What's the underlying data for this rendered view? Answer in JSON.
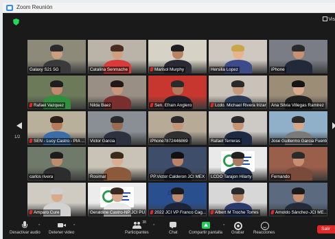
{
  "window": {
    "title": "Zoom Reunión"
  },
  "view": {
    "label": "Vis"
  },
  "pagination": {
    "page": "1/2"
  },
  "participants": [
    {
      "name": "Galaxy S21 5G",
      "muted": false
    },
    {
      "name": "Catalina Senmache",
      "muted": false
    },
    {
      "name": "Marisol Murphy",
      "muted": true
    },
    {
      "name": "Hersilia Lopez",
      "muted": false
    },
    {
      "name": "iPhone",
      "muted": false
    },
    {
      "name": "Rafael Vazquez",
      "muted": true
    },
    {
      "name": "Nilda Baez",
      "muted": false
    },
    {
      "name": "Sen. Efrain Anglero",
      "muted": true
    },
    {
      "name": "Lcdo. Michael Rivera Irizarry",
      "muted": true
    },
    {
      "name": "Ana Silvia Villegas Ramirez",
      "muted": false
    },
    {
      "name": "SEN - Lucy Castro - PIA ...",
      "muted": true
    },
    {
      "name": "Victor Garcia",
      "muted": false
    },
    {
      "name": "iPhone7872446869",
      "muted": false
    },
    {
      "name": "Rafael Terreras",
      "muted": false
    },
    {
      "name": "Jose Guillermo Garcia Fuentes",
      "muted": false
    },
    {
      "name": "carlos rivera",
      "muted": false
    },
    {
      "name": "Rosimar",
      "muted": false
    },
    {
      "name": "PP.Victor Calderon JCI MEX",
      "muted": false
    },
    {
      "name": "LCDO Tarajon Hilarty",
      "muted": false
    },
    {
      "name": "Fernando",
      "muted": false
    },
    {
      "name": "Amparo Cure",
      "muted": true
    },
    {
      "name": "Geraldine Castro-NP JCI PU...",
      "muted": false
    },
    {
      "name": "2022 JCI VP Franco Cag...",
      "muted": true
    },
    {
      "name": "Albert M Troche Torres",
      "muted": true
    },
    {
      "name": "Arnoldo Sánchez-JCI ME...",
      "muted": true
    }
  ],
  "tile_logo_text": "DUR",
  "toolbar": {
    "audio": "Desactivar audio",
    "video": "Detener video",
    "participants": "Participantes",
    "participants_count": "38",
    "chat": "Chat",
    "share": "Compartir pantalla",
    "record": "Grabar",
    "reactions": "Reacciones",
    "leave": "Salir"
  },
  "colors": {
    "speaking_border": "#8ecf3a",
    "muted_mic": "#e02828",
    "share_green": "#1fcc5c",
    "leave_red": "#e02828"
  }
}
